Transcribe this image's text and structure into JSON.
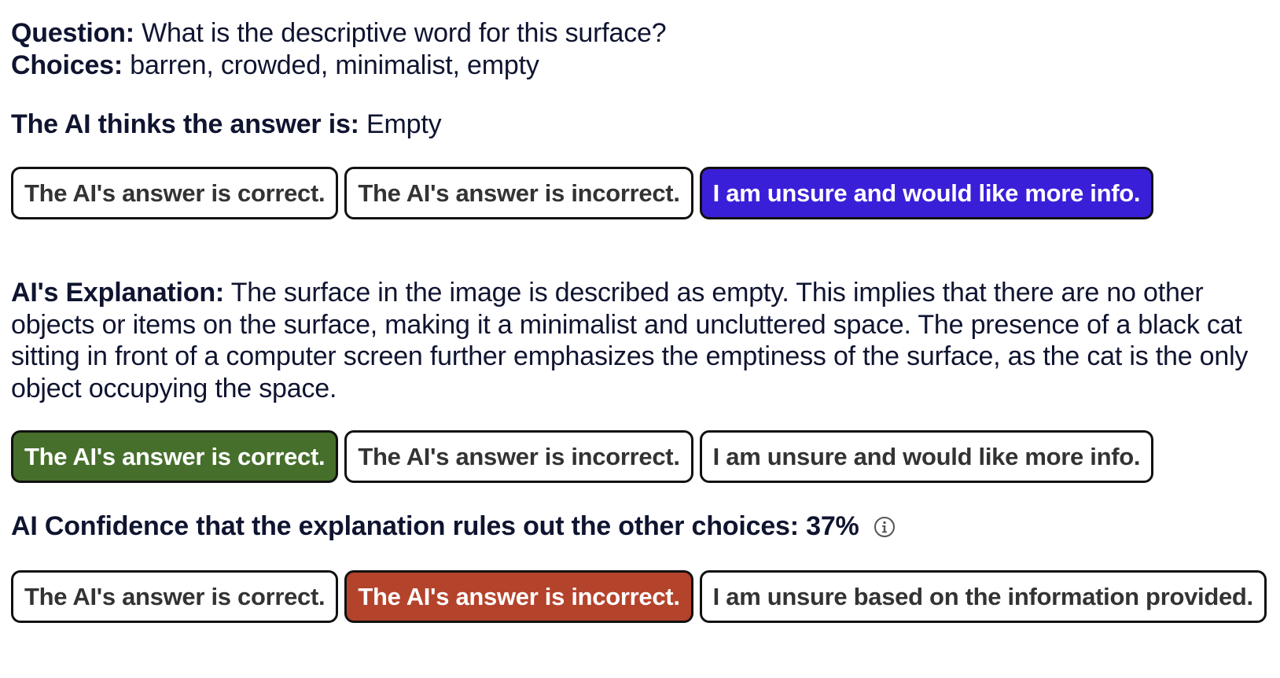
{
  "question": {
    "label": "Question:",
    "text": " What is the descriptive word for this surface?"
  },
  "choices": {
    "label": "Choices:",
    "text": " barren, crowded, minimalist, empty"
  },
  "ai_answer": {
    "label": "The AI thinks the answer is:",
    "text": " Empty"
  },
  "answer_buttons": {
    "correct": "The AI's answer is correct.",
    "incorrect": "The AI's answer is incorrect.",
    "unsure": "I am unsure and would like more info.",
    "selected": "unsure"
  },
  "explanation": {
    "label": "AI's Explanation:",
    "text": " The surface in the image is described as empty. This implies that there are no other objects or items on the surface, making it a minimalist and uncluttered space. The presence of a black cat sitting in front of a computer screen further emphasizes the emptiness of the surface, as the cat is the only object occupying the space."
  },
  "explanation_buttons": {
    "correct": "The AI's answer is correct.",
    "incorrect": "The AI's answer is incorrect.",
    "unsure": "I am unsure and would like more info.",
    "selected": "correct"
  },
  "confidence": {
    "label": "AI Confidence that the explanation rules out the other choices:",
    "value": "37%",
    "icon": "info-icon"
  },
  "confidence_buttons": {
    "correct": "The AI's answer is correct.",
    "incorrect": "The AI's answer is incorrect.",
    "unsure": "I am unsure based on the information provided.",
    "selected": "incorrect"
  },
  "colors": {
    "text": "#0f1430",
    "selected_blue": "#3a1fd8",
    "selected_green": "#476f2c",
    "selected_red": "#b4432c"
  }
}
